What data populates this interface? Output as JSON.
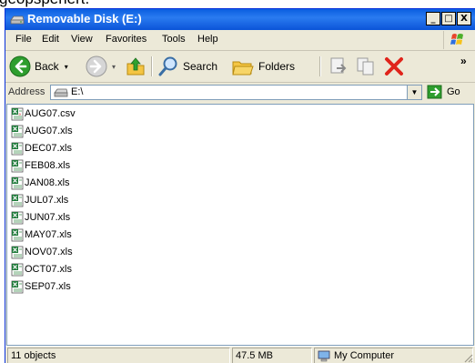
{
  "fragment_text": "geöpsperiert.",
  "window": {
    "title": "Removable Disk (E:)",
    "controls": [
      "_",
      "□",
      "X"
    ]
  },
  "menu": [
    "File",
    "Edit",
    "View",
    "Favorites",
    "Tools",
    "Help"
  ],
  "toolbar": {
    "back_label": "Back",
    "search_label": "Search",
    "folders_label": "Folders",
    "overflow": "»"
  },
  "address": {
    "label": "Address",
    "value": "E:\\",
    "go_label": "Go"
  },
  "files": [
    {
      "name": "AUG07.csv",
      "type": "csv"
    },
    {
      "name": "AUG07.xls",
      "type": "xls"
    },
    {
      "name": "DEC07.xls",
      "type": "xls"
    },
    {
      "name": "FEB08.xls",
      "type": "xls"
    },
    {
      "name": "JAN08.xls",
      "type": "xls"
    },
    {
      "name": "JUL07.xls",
      "type": "xls"
    },
    {
      "name": "JUN07.xls",
      "type": "xls"
    },
    {
      "name": "MAY07.xls",
      "type": "xls"
    },
    {
      "name": "NOV07.xls",
      "type": "xls"
    },
    {
      "name": "OCT07.xls",
      "type": "xls"
    },
    {
      "name": "SEP07.xls",
      "type": "xls"
    }
  ],
  "status": {
    "objects": "11 objects",
    "size": "47.5 MB",
    "zone": "My Computer"
  },
  "colors": {
    "titlebar": "#0a5ee0",
    "window_face": "#ece9d8",
    "excel_green": "#1f7a3a"
  }
}
